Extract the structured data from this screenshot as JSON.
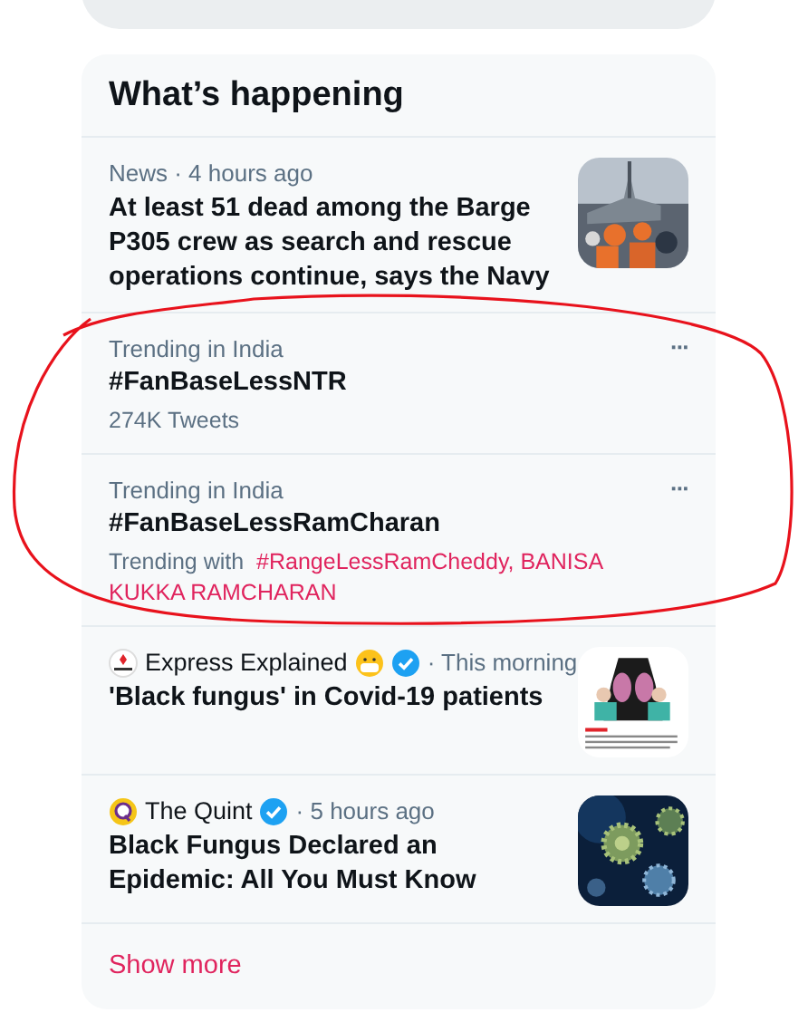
{
  "panel": {
    "title": "What’s happening"
  },
  "items": [
    {
      "kind": "news",
      "meta": "News · 4 hours ago",
      "headline": "At least 51 dead among the Barge P305 crew as search and rescue operations continue, says the Navy"
    },
    {
      "kind": "trend",
      "context": "Trending in India",
      "tag": "#FanBaseLessNTR",
      "count": "274K Tweets",
      "menu": "···"
    },
    {
      "kind": "trend",
      "context": "Trending in India",
      "tag": "#FanBaseLessRamCharan",
      "with_label": "Trending with",
      "with_links": "#RangeLessRamCheddy, BANISA KUKKA RAMCHARAN",
      "menu": "···"
    },
    {
      "kind": "source",
      "source": "Express Explained",
      "verified": true,
      "time": "· This morning",
      "headline": "'Black fungus' in Covid-19 patients"
    },
    {
      "kind": "source",
      "source": "The Quint",
      "verified": true,
      "time": "· 5 hours ago",
      "headline": "Black Fungus Declared an Epidemic: All You Must Know"
    }
  ],
  "show_more": "Show more"
}
